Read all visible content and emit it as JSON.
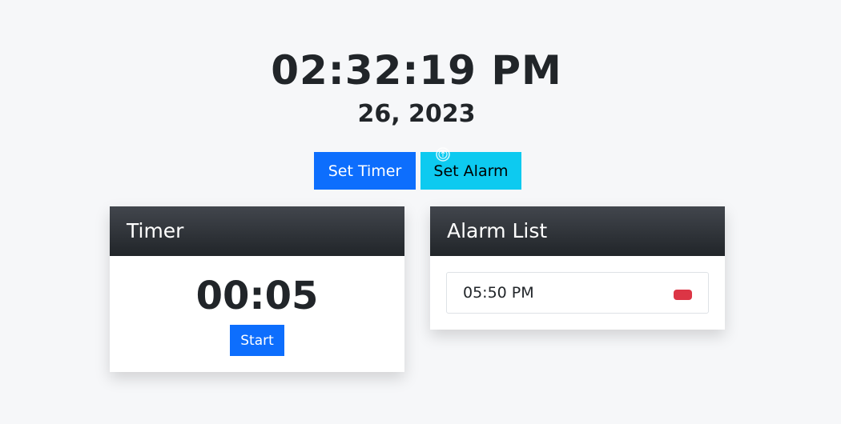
{
  "clock": {
    "time": "02:32:19 PM",
    "date": "26, 2023"
  },
  "actions": {
    "set_timer_label": "Set Timer",
    "set_alarm_label": "Set Alarm"
  },
  "timer_card": {
    "title": "Timer",
    "display": "00:05",
    "start_label": "Start"
  },
  "alarm_card": {
    "title": "Alarm List",
    "alarms": [
      {
        "time": "05:50 PM",
        "delete_color": "#dc3545"
      }
    ]
  },
  "colors": {
    "primary": "#0d6efd",
    "info": "#0dcaf0",
    "danger": "#dc3545",
    "header_dark": "#212529",
    "background": "#f6f7f9"
  },
  "icons": {
    "cursor": "pointer-cursor-icon"
  }
}
